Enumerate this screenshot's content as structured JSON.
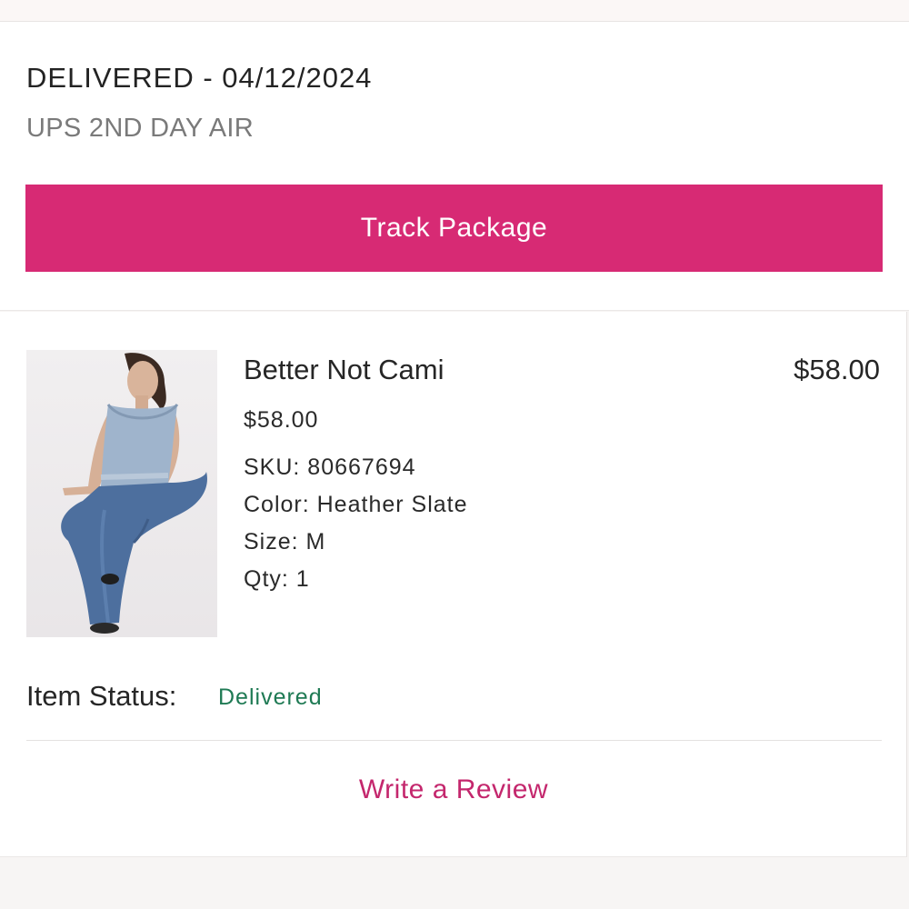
{
  "shipment": {
    "status": "DELIVERED - 04/12/2024",
    "method": "UPS 2ND DAY AIR",
    "track_label": "Track Package"
  },
  "item": {
    "name": "Better Not Cami",
    "line_total": "$58.00",
    "unit_price": "$58.00",
    "sku": "SKU: 80667694",
    "color": "Color: Heather Slate",
    "size": "Size: M",
    "qty": "Qty: 1",
    "status_label": "Item Status:",
    "status_value": "Delivered",
    "review_label": "Write a Review"
  },
  "colors": {
    "accent": "#d72a74",
    "status_green": "#1f7a54",
    "link_pink": "#c4276d"
  }
}
